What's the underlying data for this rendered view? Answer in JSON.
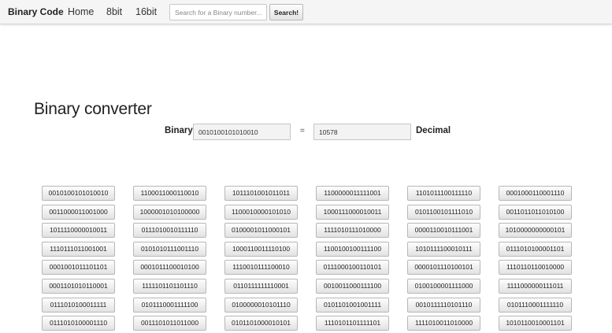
{
  "navbar": {
    "brand": "Binary Code",
    "links": [
      "Home",
      "8bit",
      "16bit"
    ],
    "search": {
      "placeholder": "Search for a Binary number...",
      "value": ""
    },
    "search_button": "Search!"
  },
  "main": {
    "title": "Binary converter",
    "converter": {
      "binary_label": "Binary",
      "binary_value": "0010100101010010",
      "equals": "=",
      "decimal_value": "10578",
      "decimal_label": "Decimal"
    },
    "binary_list": [
      [
        "0010100101010010",
        "1100011000110010",
        "1011101001011011",
        "1100000011111001",
        "1101011100111110",
        "0001000110001110"
      ],
      [
        "0011000011001000",
        "1000001010100000",
        "1100010000101010",
        "1000111000010011",
        "0101100101111010",
        "0011011011010100"
      ],
      [
        "1011110000010011",
        "0111010010111110",
        "0100001011000101",
        "1111010111010000",
        "0000110010111001",
        "1010000000000101"
      ],
      [
        "1110111011001001",
        "0101010111001110",
        "1000110011110100",
        "1100100100111100",
        "1010111100010111",
        "0111010100001101"
      ],
      [
        "0001001011101101",
        "0001011100010100",
        "1110010111100010",
        "0111000100110101",
        "0000101110100101",
        "1110110110010000"
      ],
      [
        "0001101010110001",
        "1111101101101110",
        "0110111111110001",
        "0010011000111100",
        "0100100001111000",
        "1111000000111011"
      ],
      [
        "0111010100011111",
        "0101110001111100",
        "0100000010101110",
        "0101101001001111",
        "0010111110101110",
        "0101110001111110"
      ],
      [
        "0111010100001110",
        "0011101011011000",
        "0101101000010101",
        "1110101101111101",
        "1111010011010000",
        "1010110010001101"
      ]
    ]
  }
}
